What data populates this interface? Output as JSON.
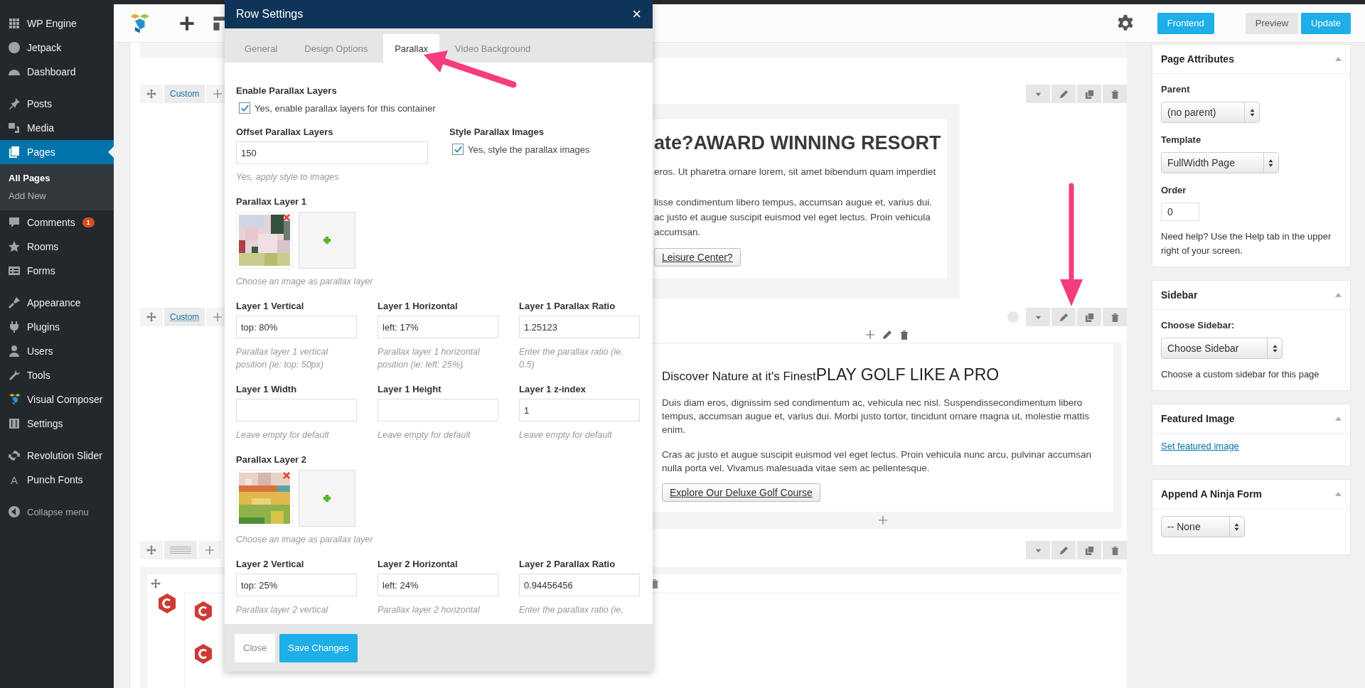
{
  "admin_menu": {
    "groups": [
      [
        {
          "label": "WP Engine",
          "selected": false
        },
        {
          "label": "Jetpack",
          "selected": false
        },
        {
          "label": "Dashboard",
          "selected": false
        }
      ],
      [
        {
          "label": "Posts",
          "selected": false
        },
        {
          "label": "Media",
          "selected": false
        },
        {
          "label": "Pages",
          "selected": true,
          "children": [
            {
              "label": "All Pages",
              "selected": true
            },
            {
              "label": "Add New",
              "selected": false
            }
          ]
        },
        {
          "label": "Comments",
          "selected": false,
          "badge": "1"
        },
        {
          "label": "Rooms",
          "selected": false
        },
        {
          "label": "Forms",
          "selected": false
        }
      ],
      [
        {
          "label": "Appearance",
          "selected": false
        },
        {
          "label": "Plugins",
          "selected": false
        },
        {
          "label": "Users",
          "selected": false
        },
        {
          "label": "Tools",
          "selected": false
        },
        {
          "label": "Visual Composer",
          "selected": false
        },
        {
          "label": "Settings",
          "selected": false
        }
      ],
      [
        {
          "label": "Revolution Slider",
          "selected": false
        },
        {
          "label": "Punch Fonts",
          "selected": false,
          "glyph": "A"
        }
      ]
    ],
    "collapse": "Collapse menu"
  },
  "toolbar": {
    "frontend": "Frontend",
    "actions": [
      {
        "label": "Preview",
        "kind": "secondary"
      },
      {
        "label": "Update",
        "kind": "primary"
      }
    ]
  },
  "modal": {
    "title": "Row Settings",
    "close": "×",
    "tabs": [
      {
        "label": "General",
        "selected": false
      },
      {
        "label": "Design Options",
        "selected": false
      },
      {
        "label": "Parallax",
        "selected": true
      },
      {
        "label": "Video Background",
        "selected": false
      }
    ],
    "enable_layers": {
      "label": "Enable Parallax Layers",
      "option": "Yes, enable parallax layers for this container",
      "checked": true
    },
    "offset": {
      "label": "Offset Parallax Layers",
      "value": "150",
      "hint": "Yes, apply style to images"
    },
    "style_images": {
      "label": "Style Parallax Images",
      "option": "Yes, style the parallax images",
      "checked": true
    },
    "layers": [
      {
        "title": "Parallax Layer 1",
        "image": {
          "kind": "picture"
        },
        "hint": "Choose an image as parallax layer",
        "fields": [
          {
            "label": "Layer 1 Vertical",
            "value": "top: 80%",
            "hint": "Parallax layer 1 vertical position (ie: top: 50px)"
          },
          {
            "label": "Layer 1 Horizontal",
            "value": "left: 17%",
            "hint": "Parallax layer 1 horizontal position (ie: left: 25%)"
          },
          {
            "label": "Layer 1 Parallax Ratio",
            "value": "1.25123",
            "hint": "Enter the parallax ratio (ie. 0.5)"
          },
          {
            "label": "Layer 1 Width",
            "hint": "Leave empty for default"
          },
          {
            "label": "Layer 1 Height",
            "hint": "Leave empty for default"
          },
          {
            "label": "Layer 1 z-index",
            "value": "1",
            "hint": "Leave empty for default"
          }
        ]
      },
      {
        "title": "Parallax Layer 2",
        "image": {
          "kind": "picture"
        },
        "hint": "Choose an image as parallax layer",
        "fields": [
          {
            "label": "Layer 2 Vertical",
            "value": "top: 25%",
            "hint": "Parallax layer 2 vertical"
          },
          {
            "label": "Layer 2 Horizontal",
            "value": "left: 24%",
            "hint": "Parallax layer 2 horizontal"
          },
          {
            "label": "Layer 2 Parallax Ratio",
            "value": "0.94456456",
            "hint": "Enter the parallax ratio (ie."
          }
        ]
      }
    ],
    "buttons": [
      {
        "label": "Close",
        "kind": "secondary"
      },
      {
        "label": "Save Changes",
        "kind": "primary"
      }
    ]
  },
  "canvas": {
    "row_1": {
      "label": "Custom",
      "heading": "ate?AWARD WINNING RESORT",
      "paragraphs": [
        [
          "eros. Ut pharetra ornare lorem, sit amet bibendum quam imperdiet"
        ],
        [
          "lisse condimentum libero tempus, accumsan augue et, varius dui.",
          "ac justo et augue suscipit euismod vel eget lectus. Proin vehicula",
          "accumsan."
        ]
      ],
      "button": "Leisure Center?"
    },
    "row_2": {
      "label": "Custom",
      "heading": "Discover Nature at it's Finest",
      "heading_large": "PLAY GOLF LIKE A PRO",
      "paragraphs": [
        "Duis diam eros, dignissim sed condimentum ac, vehicula nec nisl. Suspendissecondimentum libero tempus, accumsan augue et, varius dui. Morbi justo tortor, tincidunt ornare magna ut, molestie mattis enim.",
        "Cras ac justo et augue suscipit euismod vel eget lectus. Proin vehicula nunc arcu, pulvinar accumsan nulla porta vel. Vivamus malesuada vitae sem ac pellentesque."
      ],
      "button": "Explore Our Deluxe Golf Course"
    }
  },
  "sidebar_boxes": [
    {
      "title": "Page Attributes",
      "items": [
        {
          "kind": "label",
          "text": "Parent"
        },
        {
          "kind": "select",
          "text": "(no parent)"
        },
        {
          "kind": "label",
          "text": "Template"
        },
        {
          "kind": "select",
          "text": "FullWidth Page"
        },
        {
          "kind": "label",
          "text": "Order"
        },
        {
          "kind": "input",
          "text": "0"
        },
        {
          "kind": "note",
          "text": "Need help? Use the Help tab in the upper right of your screen."
        }
      ]
    },
    {
      "title": "Sidebar",
      "items": [
        {
          "kind": "label",
          "text": "Choose Sidebar:"
        },
        {
          "kind": "select",
          "text": "Choose Sidebar"
        },
        {
          "kind": "note",
          "text": "Choose a custom sidebar for this page"
        }
      ]
    },
    {
      "title": "Featured Image",
      "items": [
        {
          "kind": "link",
          "text": "Set featured image"
        }
      ]
    },
    {
      "title": "Append A Ninja Form",
      "items": [
        {
          "kind": "select",
          "text": "-- None"
        }
      ]
    }
  ]
}
